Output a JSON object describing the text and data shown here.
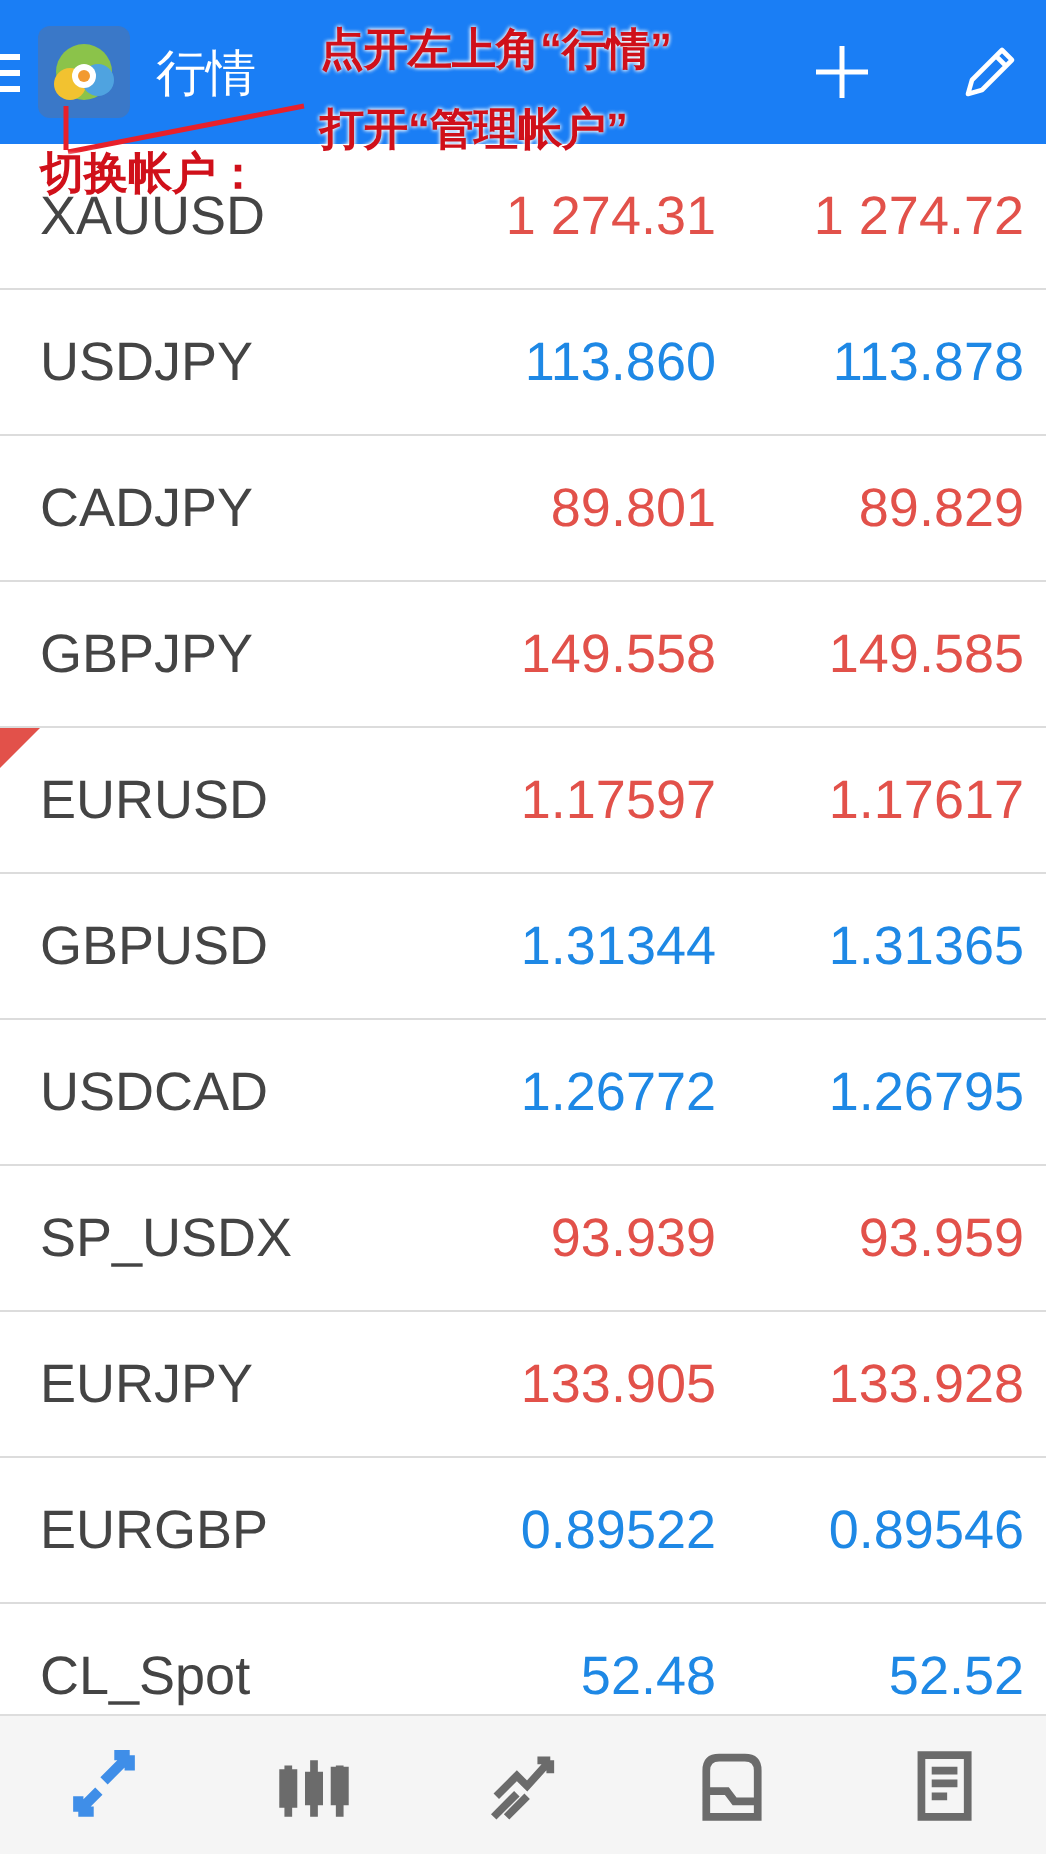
{
  "header": {
    "title": "行情"
  },
  "annotations": [
    "点开左上角“行情”",
    "打开“管理帐户”",
    "切换帐户："
  ],
  "quotes": [
    {
      "symbol": "XAUUSD",
      "bid": "1 274.31",
      "ask": "1 274.72",
      "color": "#e2514a",
      "flagged": false
    },
    {
      "symbol": "USDJPY",
      "bid": "113.860",
      "ask": "113.878",
      "color": "#1e88e5",
      "flagged": false
    },
    {
      "symbol": "CADJPY",
      "bid": "89.801",
      "ask": "89.829",
      "color": "#e2514a",
      "flagged": false
    },
    {
      "symbol": "GBPJPY",
      "bid": "149.558",
      "ask": "149.585",
      "color": "#e2514a",
      "flagged": false
    },
    {
      "symbol": "EURUSD",
      "bid": "1.17597",
      "ask": "1.17617",
      "color": "#e2514a",
      "flagged": true
    },
    {
      "symbol": "GBPUSD",
      "bid": "1.31344",
      "ask": "1.31365",
      "color": "#1e88e5",
      "flagged": false
    },
    {
      "symbol": "USDCAD",
      "bid": "1.26772",
      "ask": "1.26795",
      "color": "#1e88e5",
      "flagged": false
    },
    {
      "symbol": "SP_USDX",
      "bid": "93.939",
      "ask": "93.959",
      "color": "#e2514a",
      "flagged": false
    },
    {
      "symbol": "EURJPY",
      "bid": "133.905",
      "ask": "133.928",
      "color": "#e2514a",
      "flagged": false
    },
    {
      "symbol": "EURGBP",
      "bid": "0.89522",
      "ask": "0.89546",
      "color": "#1e88e5",
      "flagged": false
    },
    {
      "symbol": "CL_Spot",
      "bid": "52.48",
      "ask": "52.52",
      "color": "#1e88e5",
      "flagged": false
    }
  ],
  "nav": [
    {
      "kind": "quotes",
      "selected": true
    },
    {
      "kind": "chart",
      "selected": false
    },
    {
      "kind": "trade",
      "selected": false
    },
    {
      "kind": "history",
      "selected": false
    },
    {
      "kind": "news",
      "selected": false
    }
  ]
}
